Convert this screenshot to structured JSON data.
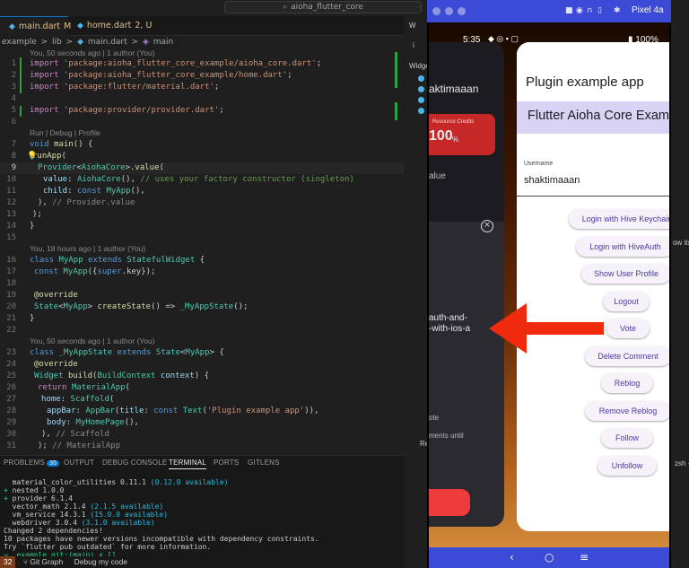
{
  "window": {
    "search_text": "aioha_flutter_core"
  },
  "tabs": [
    {
      "label": "main.dart",
      "modifier": "M",
      "active": true
    },
    {
      "label": "home.dart",
      "modifier": "2, U",
      "active": false
    }
  ],
  "breadcrumb": [
    "example",
    ">",
    "lib",
    ">",
    "main.dart",
    ">",
    "main"
  ],
  "lens": {
    "blame_top": "You, 50 seconds ago | 1 author (You)",
    "run_debug": "Run | Debug | Profile",
    "blame_myapp": "You, 18 hours ago | 1 author (You)",
    "blame_state": "You, 50 seconds ago | 1 author (You)"
  },
  "code": {
    "l1_kw": "import",
    "l1_str": "'package:aioha_flutter_core_example/aioha_core.dart'",
    "l1_end": ";",
    "l2_kw": "import",
    "l2_str": "'package:aioha_flutter_core_example/home.dart'",
    "l2_end": ";",
    "l3_kw": "import",
    "l3_str": "'package:flutter/material.dart'",
    "l3_end": ";",
    "l5_kw": "import",
    "l5_str": "'package:provider/provider.dart'",
    "l5_end": ";",
    "l7_kw": "void",
    "l7_fn": "main",
    "l7_rest": "() {",
    "l8_fn": "runApp",
    "l8_rest": "(",
    "l9_ty": "Provider",
    "l9_lt": "<",
    "l9_ty2": "AiohaCore",
    "l9_gt": ">.",
    "l9_fn": "value",
    "l9_rest": "(",
    "l10_pm": "value",
    "l10_colon": ": ",
    "l10_ty": "AiohaCore",
    "l10_rest": "(), ",
    "l10_cm": "// uses your factory constructor (singleton)",
    "l11_pm": "child",
    "l11_colon": ": ",
    "l11_kw": "const",
    "l11_ty": "MyApp",
    "l11_rest": "(),",
    "l12_text": "), ",
    "l12_cm": "// Provider.value",
    "l13_text": ");",
    "l14_text": "}",
    "l16_kw": "class",
    "l16_ty": "MyApp",
    "l16_kw2": "extends",
    "l16_ty2": "StatefulWidget",
    "l16_rest": " {",
    "l17_kw": "const",
    "l17_ty": "MyApp",
    "l17_rest": "({",
    "l17_kw2": "super",
    "l17_rest2": ".key});",
    "l19_text": "@override",
    "l20_ty": "State",
    "l20_lt": "<",
    "l20_ty2": "MyApp",
    "l20_gt": "> ",
    "l20_fn": "createState",
    "l20_rest": "() => ",
    "l20_ty3": "_MyAppState",
    "l20_end": "();",
    "l21_text": "}",
    "l23_kw": "class",
    "l23_ty": "_MyAppState",
    "l23_kw2": "extends",
    "l23_ty2": "State",
    "l23_lt": "<",
    "l23_ty3": "MyApp",
    "l23_rest": "> {",
    "l24_text": "@override",
    "l25_ty": "Widget",
    "l25_fn": "build",
    "l25_rest": "(",
    "l25_ty2": "BuildContext",
    "l25_pm": " context",
    "l25_end": ") {",
    "l26_kw": "return",
    "l26_ty": "MaterialApp",
    "l26_rest": "(",
    "l27_pm": "home",
    "l27_colon": ": ",
    "l27_ty": "Scaffold",
    "l27_rest": "(",
    "l28_pm": "appBar",
    "l28_colon": ": ",
    "l28_ty": "AppBar",
    "l28_rest": "(",
    "l28_pm2": "title",
    "l28_colon2": ": ",
    "l28_kw": "const",
    "l28_ty2": "Text",
    "l28_p": "(",
    "l28_str": "'Plugin example app'",
    "l28_end": ")),",
    "l29_pm": "body",
    "l29_colon": ": ",
    "l29_ty": "MyHomePage",
    "l29_rest": "(),",
    "l30_text": "), ",
    "l30_cm": "// Scaffold",
    "l31_text": "); ",
    "l31_cm": "// MaterialApp"
  },
  "panel": {
    "tabs": [
      "PROBLEMS",
      "OUTPUT",
      "DEBUG CONSOLE",
      "TERMINAL",
      "PORTS",
      "GITLENS"
    ],
    "problems_count": "35",
    "terminal": {
      "l1_name": "material_color_utilities 0.11.1",
      "l1_avail": "(0.12.0 available)",
      "l2_plus": "+",
      "l2_name": "nested 1.0.0",
      "l3_plus": "+",
      "l3_name": "provider 6.1.4",
      "l4_name": "vector_math 2.1.4",
      "l4_avail": "(2.1.5 available)",
      "l5_name": "vm_service 14.3.1",
      "l5_avail": "(15.0.0 available)",
      "l6_name": "webdriver 3.0.4",
      "l6_avail": "(3.1.0 available)",
      "l7": "Changed 2 dependencies!",
      "l8": "10 packages have newer versions incompatible with dependency constraints.",
      "l9": "Try `flutter pub outdated` for more information.",
      "l10_prompt": "→  example git:(main) ✗ []"
    }
  },
  "statusbar": {
    "num": "32",
    "git_graph": "Git Graph",
    "debug": "Debug my code"
  },
  "side_panel": {
    "widget_label": "Widge",
    "tab_w": "W",
    "tab_i": "i",
    "re_label": "Re",
    "lats": "ow its la",
    "zsh": "zsh -"
  },
  "emulator": {
    "title": "Pixel 4a",
    "time": "5:35",
    "battery": "100%",
    "left_card": {
      "user": "aktimaaan",
      "credits_label": "Resource Credits",
      "credits_value": "100",
      "credits_unit": "%",
      "value_label": "alue",
      "close_glyph": "×",
      "article_line1": "auth-and-",
      "article_line2": "-with-ios-a",
      "vote_label": "ote",
      "comments": "ments until"
    },
    "app_title": "Plugin example app",
    "banner": "Flutter Aioha Core Example",
    "username_label": "Username",
    "username_value": "shaktimaaan",
    "buttons": [
      "Login with Hive Keychain",
      "Login with HiveAuth",
      "Show User Profile",
      "Logout",
      "Vote",
      "Delete Comment",
      "Reblog",
      "Remove Reblog",
      "Follow",
      "Unfollow"
    ]
  },
  "colors": {
    "accent": "#3c4bd6",
    "arrow": "#f02a0c",
    "banner": "#d9d3f5"
  }
}
